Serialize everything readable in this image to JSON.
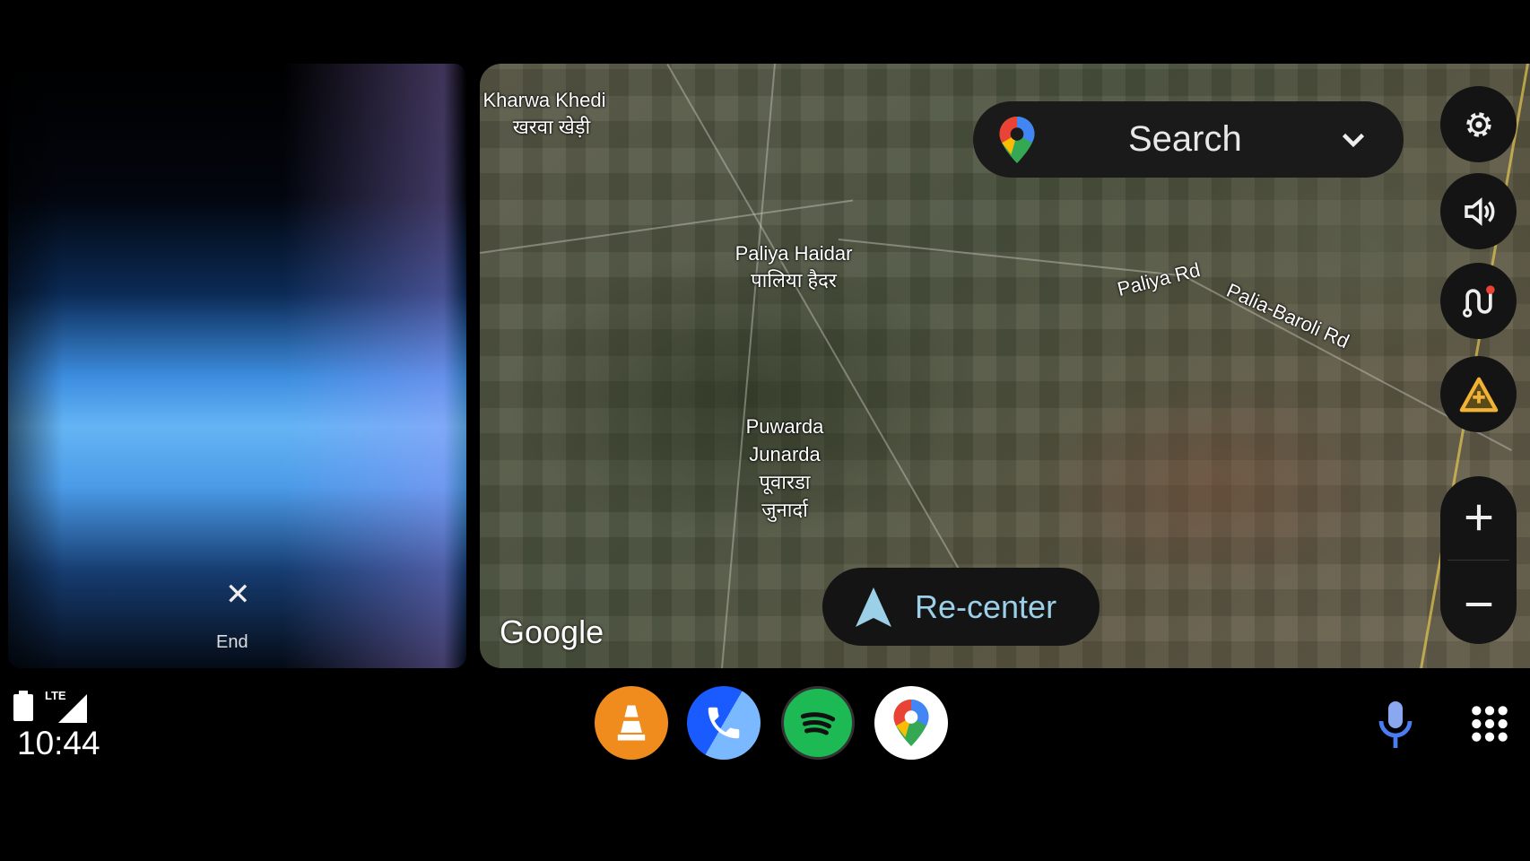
{
  "call": {
    "end_label": "End",
    "end_icon": "close-icon"
  },
  "map": {
    "labels": {
      "kharwa_en": "Kharwa Khedi",
      "kharwa_hi": "खरवा खेड़ी",
      "paliya_en": "Paliya Haidar",
      "paliya_hi": "पालिया हैदर",
      "puwarda_en": "Puwarda",
      "junarda_en": "Junarda",
      "puwarda_hi": "पूवारडा",
      "junarda_hi": "जुनार्दा",
      "paliya_rd": "Paliya Rd",
      "palia_baroli_rd": "Palia-Baroli Rd"
    },
    "attribution": "Google",
    "search_label": "Search",
    "recenter_label": "Re-center",
    "controls": [
      "gear-icon",
      "volume-icon",
      "route-icon",
      "report-hazard-icon",
      "zoom-in-icon",
      "zoom-out-icon"
    ]
  },
  "status": {
    "network": "LTE",
    "time": "10:44"
  },
  "dock": {
    "apps": [
      "VLC",
      "Phone",
      "Spotify",
      "Google Maps"
    ]
  },
  "colors": {
    "accent": "#9bd0e8",
    "background": "#000000"
  }
}
